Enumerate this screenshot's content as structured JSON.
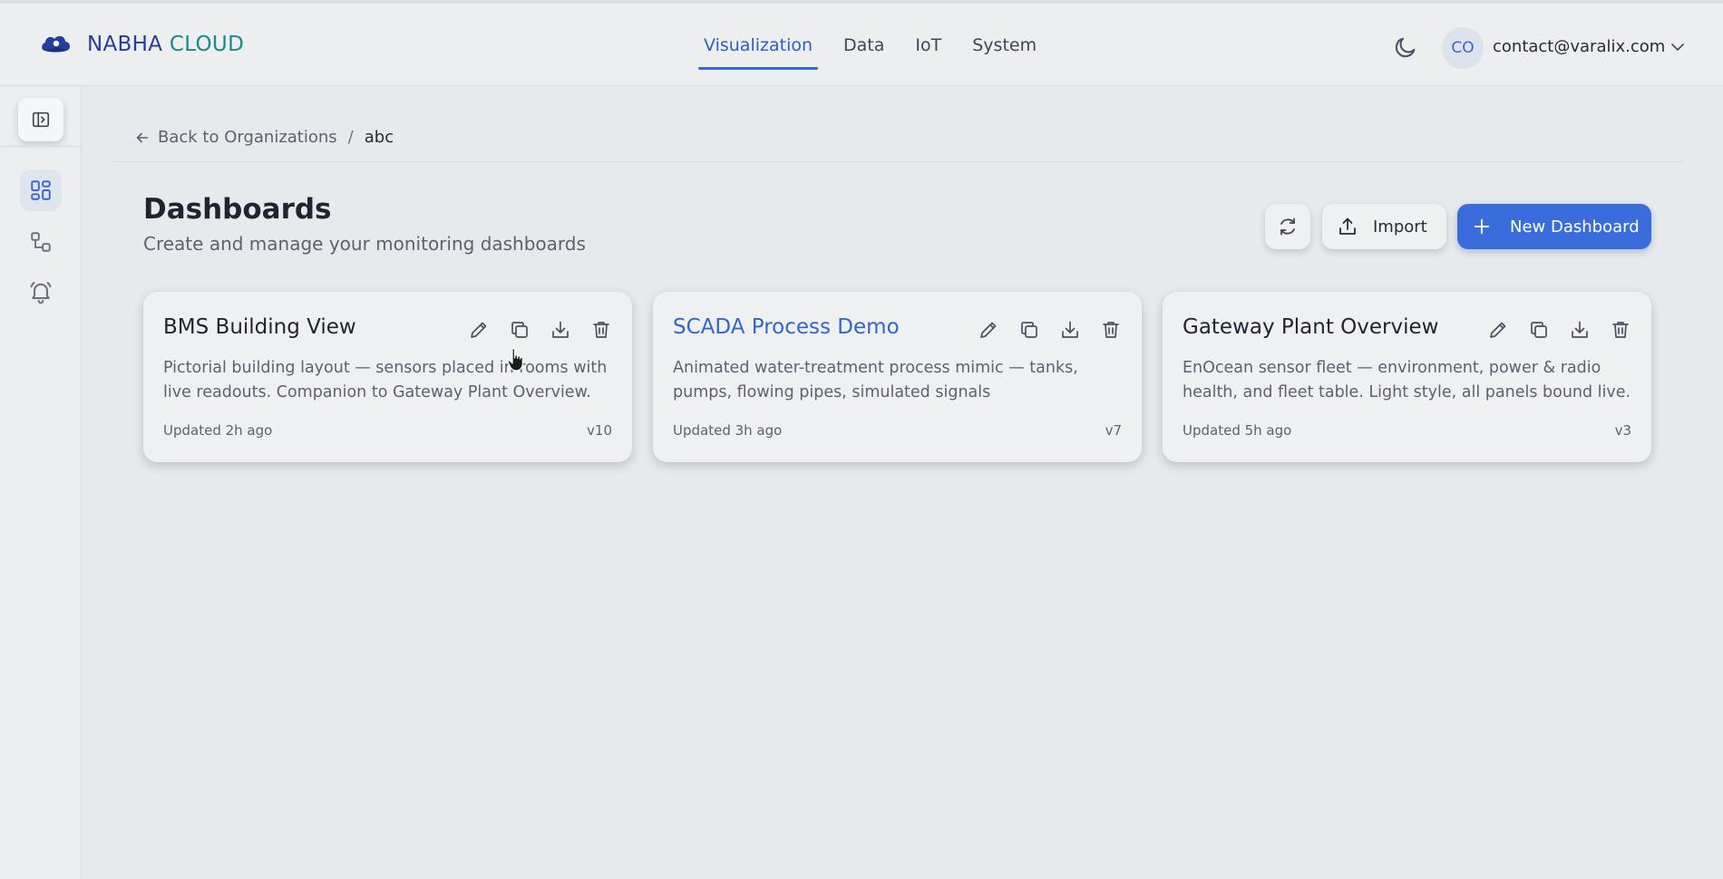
{
  "brand": {
    "name_part1": "NABHA",
    "name_part2": "CLOUD"
  },
  "nav": {
    "items": [
      {
        "label": "Visualization",
        "active": true
      },
      {
        "label": "Data",
        "active": false
      },
      {
        "label": "IoT",
        "active": false
      },
      {
        "label": "System",
        "active": false
      }
    ]
  },
  "user": {
    "initials": "CO",
    "email": "contact@varalix.com"
  },
  "icons": {
    "logo": "cloud-logo-icon",
    "theme": "moon-icon",
    "user_menu": "chevron-down-icon",
    "sidebar_toggle": "panel-toggle-icon",
    "sidebar": [
      "dashboard-grid-icon",
      "workflow-icon",
      "alarm-bell-icon"
    ],
    "back": "arrow-left-icon",
    "refresh": "refresh-icon",
    "import": "upload-icon",
    "new": "plus-icon",
    "card_actions": [
      "pencil-icon",
      "copy-icon",
      "download-icon",
      "trash-icon"
    ]
  },
  "breadcrumb": {
    "back_label": "Back to Organizations",
    "separator": "/",
    "current": "abc"
  },
  "page": {
    "title": "Dashboards",
    "subtitle": "Create and manage your monitoring dashboards"
  },
  "actions": {
    "import_label": "Import",
    "new_label": "New Dashboard"
  },
  "cards": [
    {
      "title": "BMS Building View",
      "description": "Pictorial building layout — sensors placed in rooms with live readouts. Companion to Gateway Plant Overview.",
      "updated": "Updated 2h ago",
      "version": "v10"
    },
    {
      "title": "SCADA Process Demo",
      "description": "Animated water-treatment process mimic — tanks, pumps, flowing pipes, simulated signals",
      "updated": "Updated 3h ago",
      "version": "v7"
    },
    {
      "title": "Gateway Plant Overview",
      "description": "EnOcean sensor fleet — environment, power & radio health, and fleet table. Light style, all panels bound live.",
      "updated": "Updated 5h ago",
      "version": "v3"
    }
  ],
  "colors": {
    "accent": "#3a6cdc",
    "brand_dark": "#243f99",
    "brand_teal": "#1b8a86",
    "background": "#e7eaed"
  }
}
